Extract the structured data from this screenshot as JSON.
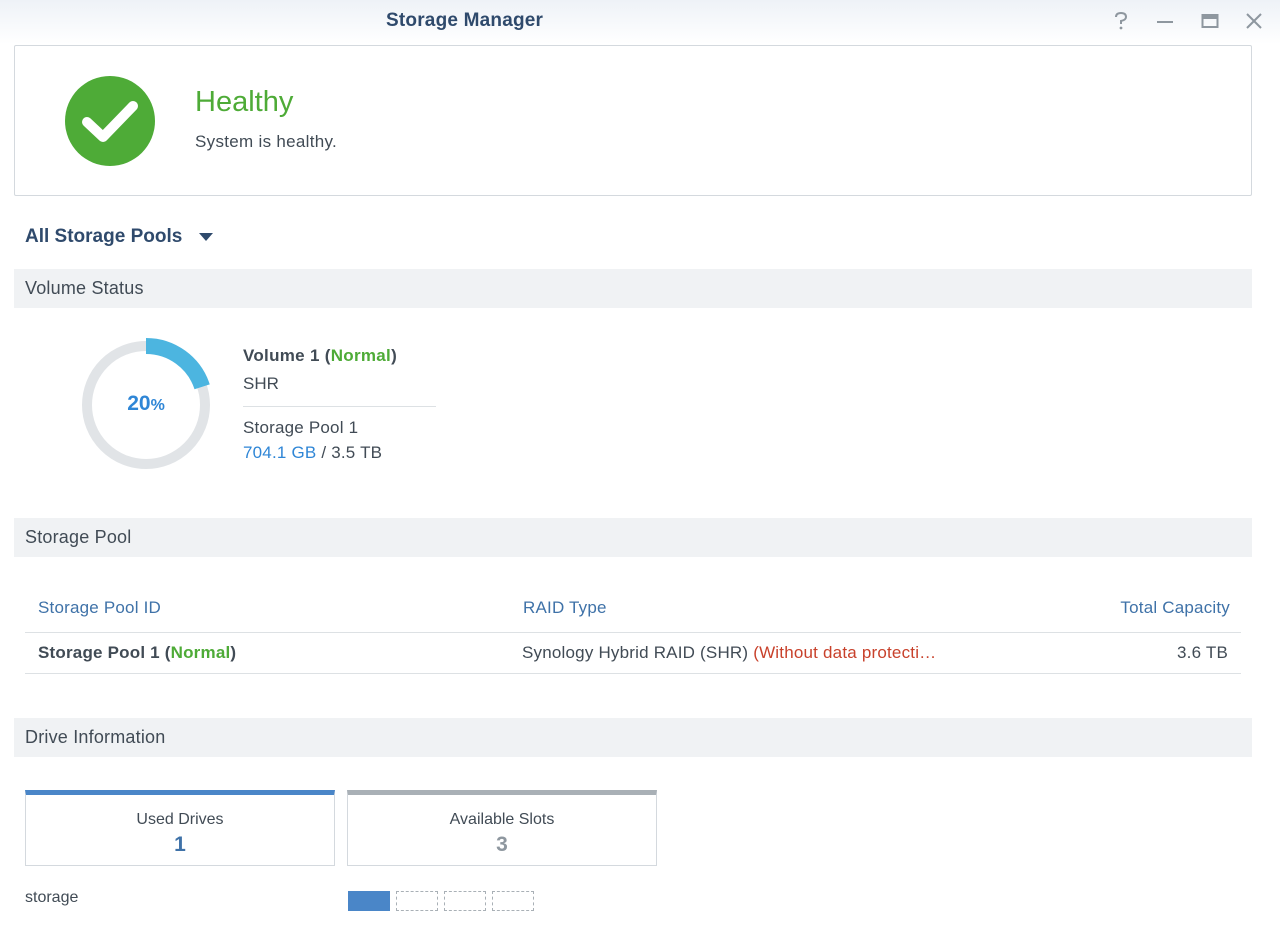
{
  "window": {
    "title": "Storage Manager",
    "help_icon": "help-icon",
    "minimize_icon": "minimize-icon",
    "maximize_icon": "maximize-icon",
    "close_icon": "close-icon"
  },
  "health": {
    "status": "Healthy",
    "message": "System is healthy.",
    "icon": "checkmark-icon",
    "color": "#4eab37"
  },
  "pool_selector": {
    "label": "All Storage Pools"
  },
  "sections": {
    "volume_status": "Volume Status",
    "storage_pool": "Storage Pool",
    "drive_information": "Drive Information"
  },
  "volume": {
    "usage_percent": 20,
    "usage_value": "20",
    "usage_unit": "%",
    "name": "Volume 1",
    "status": "Normal",
    "type": "SHR",
    "pool": "Storage Pool 1",
    "used": "704.1 GB",
    "separator": " / ",
    "total": "3.5 TB"
  },
  "pool_table": {
    "headers": [
      "Storage Pool ID",
      "RAID Type",
      "Total Capacity"
    ],
    "rows": [
      {
        "name": "Storage Pool 1",
        "status": "Normal",
        "raid": "Synology Hybrid RAID (SHR)",
        "raid_note": "(Without data protecti…",
        "capacity": "3.6 TB"
      }
    ]
  },
  "drives": {
    "used_label": "Used Drives",
    "used_count": "1",
    "available_label": "Available Slots",
    "available_count": "3",
    "storage_label": "storage",
    "slots_used": 1,
    "slots_total": 4
  },
  "colors": {
    "accent_blue": "#2f86d6",
    "title_blue": "#2f4a6c",
    "healthy_green": "#4eab37",
    "warning_red": "#c8412b",
    "donut_fill": "#4cb5e0",
    "donut_track": "#e1e4e7"
  }
}
